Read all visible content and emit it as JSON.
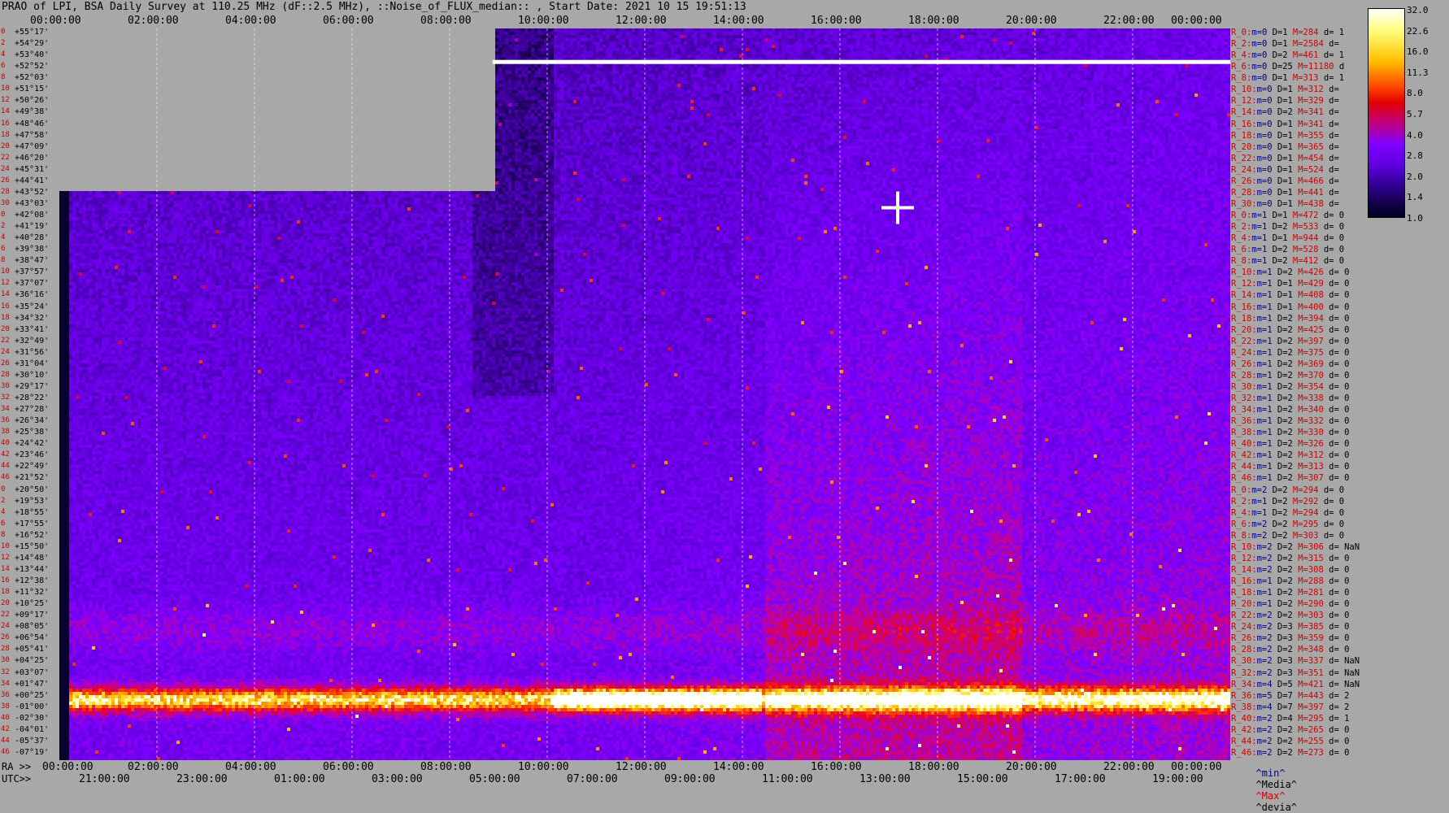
{
  "title": "PRAO of LPI, BSA Daily Survey at 110.25 MHz (dF::2.5 MHz), ::Noise_of_FLUX_median:: , Start Date: 2021 10 15 19:51:13",
  "chart_data": {
    "type": "heatmap",
    "title": "PRAO of LPI, BSA Daily Survey at 110.25 MHz (dF::2.5 MHz), ::Noise_of_FLUX_median:: , Start Date: 2021 10 15 19:51:13",
    "x_top_ticks": [
      "00:00:00",
      "02:00:00",
      "04:00:00",
      "06:00:00",
      "08:00:00",
      "10:00:00",
      "12:00:00",
      "14:00:00",
      "16:00:00",
      "18:00:00",
      "20:00:00",
      "22:00:00",
      "00:00:00"
    ],
    "x_bottom_ra_prefix": "RA >>",
    "x_bottom_ra_ticks": [
      "00:00:00",
      "02:00:00",
      "04:00:00",
      "06:00:00",
      "08:00:00",
      "10:00:00",
      "12:00:00",
      "14:00:00",
      "16:00:00",
      "18:00:00",
      "20:00:00",
      "22:00:00",
      "00:00:00"
    ],
    "x_bottom_utc_prefix": "UTC>>",
    "x_bottom_utc_ticks": [
      "21:0",
      "0:00",
      "23:0",
      "0:00",
      "01:0",
      "0:00",
      "03:0",
      "0:00",
      "05:0",
      "0:00",
      "07:0",
      "0:00",
      "09:0",
      "0:00",
      "11:0",
      "0:00",
      "13:0",
      "0:00",
      "15:0",
      "0:00",
      "17:0",
      "0:00",
      "19:0",
      "0:00"
    ],
    "utc_labels": [
      "21:00:00",
      "23:00:00",
      "01:00:00",
      "03:00:00",
      "05:00:00",
      "07:00:00",
      "09:00:00",
      "11:00:00",
      "13:00:00",
      "15:00:00",
      "17:00:00",
      "19:00:00"
    ],
    "y_labels": [
      "+55°17'",
      "+54°29'",
      "+53°40'",
      "+52°52'",
      "+52°03'",
      "+51°15'",
      "+50°26'",
      "+49°38'",
      "+48°46'",
      "+47°58'",
      "+47°09'",
      "+46°20'",
      "+45°31'",
      "+44°41'",
      "+43°52'",
      "+43°03'",
      "+42°08'",
      "+41°19'",
      "+40°28'",
      "+39°38'",
      "+38°47'",
      "+37°57'",
      "+37°07'",
      "+36°16'",
      "+35°24'",
      "+34°32'",
      "+33°41'",
      "+32°49'",
      "+31°56'",
      "+31°04'",
      "+30°10'",
      "+29°17'",
      "+28°22'",
      "+27°28'",
      "+26°34'",
      "+25°38'",
      "+24°42'",
      "+23°46'",
      "+22°49'",
      "+21°52'",
      "+20°50'",
      "+19°53'",
      "+18°55'",
      "+17°55'",
      "+16°52'",
      "+15°50'",
      "+14°48'",
      "+13°44'",
      "+12°38'",
      "+11°32'",
      "+10°25'",
      "+09°17'",
      "+08°05'",
      "+06°54'",
      "+05°41'",
      "+04°25'",
      "+03°07'",
      "+01°47'",
      "+00°25'",
      "-01°00'",
      "-02°30'",
      "-04°01'",
      "-05°37'",
      "-07°19'"
    ],
    "y_index": [
      "0",
      "2",
      "4",
      "6",
      "8",
      "10",
      "12",
      "14",
      "16",
      "18",
      "20",
      "22",
      "24",
      "26",
      "28",
      "30",
      "0",
      "2",
      "4",
      "6",
      "8",
      "10",
      "12",
      "14",
      "16",
      "18",
      "20",
      "22",
      "24",
      "26",
      "28",
      "30",
      "32",
      "34",
      "36",
      "38",
      "40",
      "42",
      "44",
      "46",
      "0",
      "2",
      "4",
      "6",
      "8",
      "10",
      "12",
      "14",
      "16",
      "18",
      "20",
      "22",
      "24",
      "26",
      "28",
      "30",
      "32",
      "34",
      "36",
      "38",
      "40",
      "42",
      "44",
      "46"
    ],
    "colorbar": {
      "values": [
        32.0,
        22.6,
        16.0,
        11.3,
        8.0,
        5.7,
        4.0,
        2.8,
        2.0,
        1.4,
        1.0
      ]
    },
    "colors": {
      "low": "#000020",
      "mid": "#8000ff",
      "high": "#ff2000",
      "top": "#ffffff",
      "missing": "#a8a8a8"
    }
  },
  "right_rows": [
    {
      "n": "R_0:",
      "m": "m=0",
      "d": "D=1",
      "h": "M=284",
      "dv": "d= 1"
    },
    {
      "n": "R_2:",
      "m": "m=0",
      "d": "D=1",
      "h": "M=2584",
      "dv": "d="
    },
    {
      "n": "R_4:",
      "m": "m=0",
      "d": "D=2",
      "h": "M=461",
      "dv": "d= 1"
    },
    {
      "n": "R_6:",
      "m": "m=0",
      "d": "D=25",
      "h": "M=11180",
      "dv": "d"
    },
    {
      "n": "R_8:",
      "m": "m=0",
      "d": "D=1",
      "h": "M=313",
      "dv": "d= 1"
    },
    {
      "n": "R_10:",
      "m": "m=0",
      "d": "D=1",
      "h": "M=312",
      "dv": "d="
    },
    {
      "n": "R_12:",
      "m": "m=0",
      "d": "D=1",
      "h": "M=329",
      "dv": "d="
    },
    {
      "n": "R_14:",
      "m": "m=0",
      "d": "D=2",
      "h": "M=341",
      "dv": "d="
    },
    {
      "n": "R_16:",
      "m": "m=0",
      "d": "D=1",
      "h": "M=341",
      "dv": "d="
    },
    {
      "n": "R_18:",
      "m": "m=0",
      "d": "D=1",
      "h": "M=355",
      "dv": "d="
    },
    {
      "n": "R_20:",
      "m": "m=0",
      "d": "D=1",
      "h": "M=365",
      "dv": "d="
    },
    {
      "n": "R_22:",
      "m": "m=0",
      "d": "D=1",
      "h": "M=454",
      "dv": "d="
    },
    {
      "n": "R_24:",
      "m": "m=0",
      "d": "D=1",
      "h": "M=524",
      "dv": "d="
    },
    {
      "n": "R_26:",
      "m": "m=0",
      "d": "D=1",
      "h": "M=466",
      "dv": "d="
    },
    {
      "n": "R_28:",
      "m": "m=0",
      "d": "D=1",
      "h": "M=441",
      "dv": "d="
    },
    {
      "n": "R_30:",
      "m": "m=0",
      "d": "D=1",
      "h": "M=438",
      "dv": "d="
    },
    {
      "n": "R_0:",
      "m": "m=1",
      "d": "D=1",
      "h": "M=472",
      "dv": "d= 0"
    },
    {
      "n": "R_2:",
      "m": "m=1",
      "d": "D=2",
      "h": "M=533",
      "dv": "d= 0"
    },
    {
      "n": "R_4:",
      "m": "m=1",
      "d": "D=1",
      "h": "M=944",
      "dv": "d= 0"
    },
    {
      "n": "R_6:",
      "m": "m=1",
      "d": "D=2",
      "h": "M=528",
      "dv": "d= 0"
    },
    {
      "n": "R_8:",
      "m": "m=1",
      "d": "D=2",
      "h": "M=412",
      "dv": "d= 0"
    },
    {
      "n": "R_10:",
      "m": "m=1",
      "d": "D=2",
      "h": "M=426",
      "dv": "d= 0"
    },
    {
      "n": "R_12:",
      "m": "m=1",
      "d": "D=1",
      "h": "M=429",
      "dv": "d= 0"
    },
    {
      "n": "R_14:",
      "m": "m=1",
      "d": "D=1",
      "h": "M=408",
      "dv": "d= 0"
    },
    {
      "n": "R_16:",
      "m": "m=1",
      "d": "D=1",
      "h": "M=400",
      "dv": "d= 0"
    },
    {
      "n": "R_18:",
      "m": "m=1",
      "d": "D=2",
      "h": "M=394",
      "dv": "d= 0"
    },
    {
      "n": "R_20:",
      "m": "m=1",
      "d": "D=2",
      "h": "M=425",
      "dv": "d= 0"
    },
    {
      "n": "R_22:",
      "m": "m=1",
      "d": "D=2",
      "h": "M=397",
      "dv": "d= 0"
    },
    {
      "n": "R_24:",
      "m": "m=1",
      "d": "D=2",
      "h": "M=375",
      "dv": "d= 0"
    },
    {
      "n": "R_26:",
      "m": "m=1",
      "d": "D=2",
      "h": "M=369",
      "dv": "d= 0"
    },
    {
      "n": "R_28:",
      "m": "m=1",
      "d": "D=2",
      "h": "M=370",
      "dv": "d= 0"
    },
    {
      "n": "R_30:",
      "m": "m=1",
      "d": "D=2",
      "h": "M=354",
      "dv": "d= 0"
    },
    {
      "n": "R_32:",
      "m": "m=1",
      "d": "D=2",
      "h": "M=338",
      "dv": "d= 0"
    },
    {
      "n": "R_34:",
      "m": "m=1",
      "d": "D=2",
      "h": "M=340",
      "dv": "d= 0"
    },
    {
      "n": "R_36:",
      "m": "m=1",
      "d": "D=2",
      "h": "M=332",
      "dv": "d= 0"
    },
    {
      "n": "R_38:",
      "m": "m=1",
      "d": "D=2",
      "h": "M=330",
      "dv": "d= 0"
    },
    {
      "n": "R_40:",
      "m": "m=1",
      "d": "D=2",
      "h": "M=326",
      "dv": "d= 0"
    },
    {
      "n": "R_42:",
      "m": "m=1",
      "d": "D=2",
      "h": "M=312",
      "dv": "d= 0"
    },
    {
      "n": "R_44:",
      "m": "m=1",
      "d": "D=2",
      "h": "M=313",
      "dv": "d= 0"
    },
    {
      "n": "R_46:",
      "m": "m=1",
      "d": "D=2",
      "h": "M=307",
      "dv": "d= 0"
    },
    {
      "n": "R_0:",
      "m": "m=2",
      "d": "D=2",
      "h": "M=294",
      "dv": "d= 0"
    },
    {
      "n": "R_2:",
      "m": "m=1",
      "d": "D=2",
      "h": "M=292",
      "dv": "d= 0"
    },
    {
      "n": "R_4:",
      "m": "m=1",
      "d": "D=2",
      "h": "M=294",
      "dv": "d= 0"
    },
    {
      "n": "R_6:",
      "m": "m=2",
      "d": "D=2",
      "h": "M=295",
      "dv": "d= 0"
    },
    {
      "n": "R_8:",
      "m": "m=2",
      "d": "D=2",
      "h": "M=303",
      "dv": "d= 0"
    },
    {
      "n": "R_10:",
      "m": "m=2",
      "d": "D=2",
      "h": "M=306",
      "dv": "d= NaN"
    },
    {
      "n": "R_12:",
      "m": "m=2",
      "d": "D=2",
      "h": "M=315",
      "dv": "d= 0"
    },
    {
      "n": "R_14:",
      "m": "m=2",
      "d": "D=2",
      "h": "M=308",
      "dv": "d= 0"
    },
    {
      "n": "R_16:",
      "m": "m=1",
      "d": "D=2",
      "h": "M=288",
      "dv": "d= 0"
    },
    {
      "n": "R_18:",
      "m": "m=1",
      "d": "D=2",
      "h": "M=281",
      "dv": "d= 0"
    },
    {
      "n": "R_20:",
      "m": "m=1",
      "d": "D=2",
      "h": "M=290",
      "dv": "d= 0"
    },
    {
      "n": "R_22:",
      "m": "m=2",
      "d": "D=2",
      "h": "M=303",
      "dv": "d= 0"
    },
    {
      "n": "R_24:",
      "m": "m=2",
      "d": "D=3",
      "h": "M=385",
      "dv": "d= 0"
    },
    {
      "n": "R_26:",
      "m": "m=2",
      "d": "D=3",
      "h": "M=359",
      "dv": "d= 0"
    },
    {
      "n": "R_28:",
      "m": "m=2",
      "d": "D=2",
      "h": "M=348",
      "dv": "d= 0"
    },
    {
      "n": "R_30:",
      "m": "m=2",
      "d": "D=3",
      "h": "M=337",
      "dv": "d= NaN"
    },
    {
      "n": "R_32:",
      "m": "m=2",
      "d": "D=3",
      "h": "M=351",
      "dv": "d= NaN"
    },
    {
      "n": "R_34:",
      "m": "m=4",
      "d": "D=5",
      "h": "M=421",
      "dv": "d= NaN"
    },
    {
      "n": "R_36:",
      "m": "m=5",
      "d": "D=7",
      "h": "M=443",
      "dv": "d= 2"
    },
    {
      "n": "R_38:",
      "m": "m=4",
      "d": "D=7",
      "h": "M=397",
      "dv": "d= 2"
    },
    {
      "n": "R_40:",
      "m": "m=2",
      "d": "D=4",
      "h": "M=295",
      "dv": "d= 1"
    },
    {
      "n": "R_42:",
      "m": "m=2",
      "d": "D=2",
      "h": "M=265",
      "dv": "d= 0"
    },
    {
      "n": "R_44:",
      "m": "m=2",
      "d": "D=2",
      "h": "M=255",
      "dv": "d= 0"
    },
    {
      "n": "R_46:",
      "m": "m=2",
      "d": "D=2",
      "h": "M=273",
      "dv": "d= 0"
    }
  ],
  "legend": {
    "min": "^min^",
    "median": "^Media^",
    "max": "^Max^",
    "devia": "^devia^"
  }
}
